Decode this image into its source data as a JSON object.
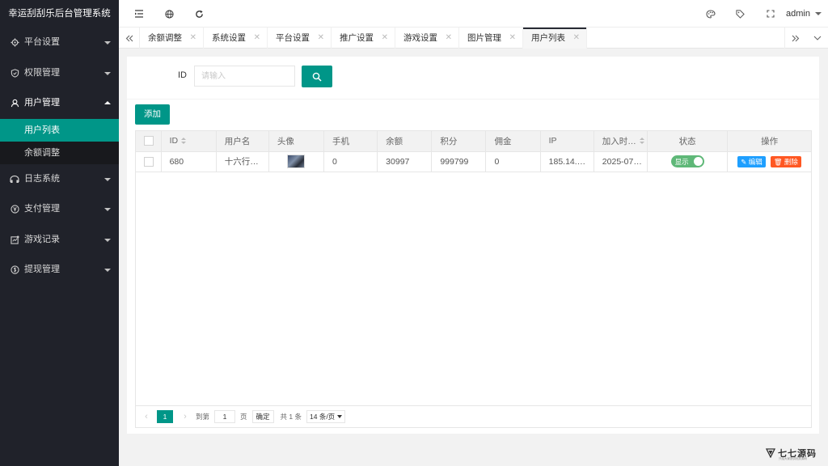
{
  "app": {
    "title": "幸运刮刮乐后台管理系统"
  },
  "sidebar": {
    "items": [
      {
        "label": "平台设置",
        "icon": "gear-icon"
      },
      {
        "label": "权限管理",
        "icon": "shield-icon"
      },
      {
        "label": "用户管理",
        "icon": "user-icon",
        "open": true,
        "children": [
          {
            "label": "用户列表",
            "active": true
          },
          {
            "label": "余额调整"
          }
        ]
      },
      {
        "label": "日志系统",
        "icon": "log-icon"
      },
      {
        "label": "支付管理",
        "icon": "payment-icon"
      },
      {
        "label": "游戏记录",
        "icon": "game-record-icon"
      },
      {
        "label": "提现管理",
        "icon": "withdraw-icon"
      }
    ]
  },
  "header": {
    "user": "admin"
  },
  "tabs": [
    {
      "label": "余额调整"
    },
    {
      "label": "系统设置"
    },
    {
      "label": "平台设置"
    },
    {
      "label": "推广设置"
    },
    {
      "label": "游戏设置"
    },
    {
      "label": "图片管理"
    },
    {
      "label": "用户列表",
      "active": true
    }
  ],
  "search": {
    "id_label": "ID",
    "placeholder": "请输入"
  },
  "toolbar": {
    "add_label": "添加"
  },
  "table": {
    "columns": [
      "ID",
      "用户名",
      "头像",
      "手机",
      "余额",
      "积分",
      "佣金",
      "IP",
      "加入时…",
      "状态",
      "操作"
    ],
    "rows": [
      {
        "id": "680",
        "username": "十六行…",
        "phone": "0",
        "balance": "30997",
        "points": "999799",
        "commission": "0",
        "ip": "185.14.…",
        "joined": "2025-07…",
        "status": "显示",
        "edit": "编辑",
        "delete": "删除"
      }
    ]
  },
  "pager": {
    "current": "1",
    "goto_label": "到第",
    "goto_value": "1",
    "page_unit": "页",
    "confirm": "确定",
    "total": "共 1 条",
    "page_size": "14 条/页"
  },
  "watermark": {
    "text": "七七源码",
    "sub": "只给大家提供优质源码"
  },
  "colors": {
    "primary": "#009688",
    "sidebar": "#20222a",
    "edit": "#1e9fff",
    "delete": "#ff5722",
    "switch_on": "#5fb878"
  }
}
